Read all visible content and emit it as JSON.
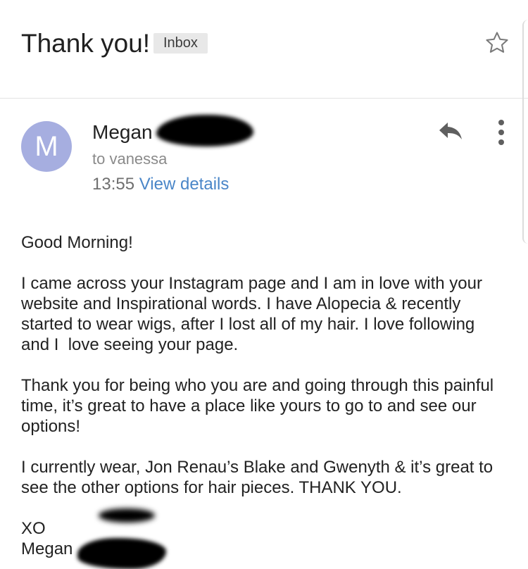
{
  "header": {
    "subject": "Thank you!",
    "label": "Inbox",
    "star_icon": "star-outline-icon"
  },
  "sender": {
    "avatar_letter": "M",
    "avatar_color": "#a6aee0",
    "name": "Megan",
    "recipient": "to vanessa",
    "time": "13:55",
    "view_details": "View details",
    "reply_icon": "reply-icon",
    "more_icon": "more-vertical-icon"
  },
  "body": {
    "greeting": "Good Morning!",
    "paragraphs": [
      "I came across your Instagram page and I am in love with your website and Inspirational words. I have Alopecia & recently started to wear wigs, after I lost all of my hair. I love following and I  love seeing your page.",
      "Thank you for being who you are and going through this painful time, it’s great to have a place like yours to go to and see our options!",
      "I currently wear, Jon Renau’s Blake and Gwenyth & it’s great to see the other options for hair pieces. THANK YOU."
    ],
    "signoff": "XO",
    "signature": "Megan"
  },
  "colors": {
    "link": "#4a86c8",
    "chip_bg": "#e8e8e8"
  }
}
